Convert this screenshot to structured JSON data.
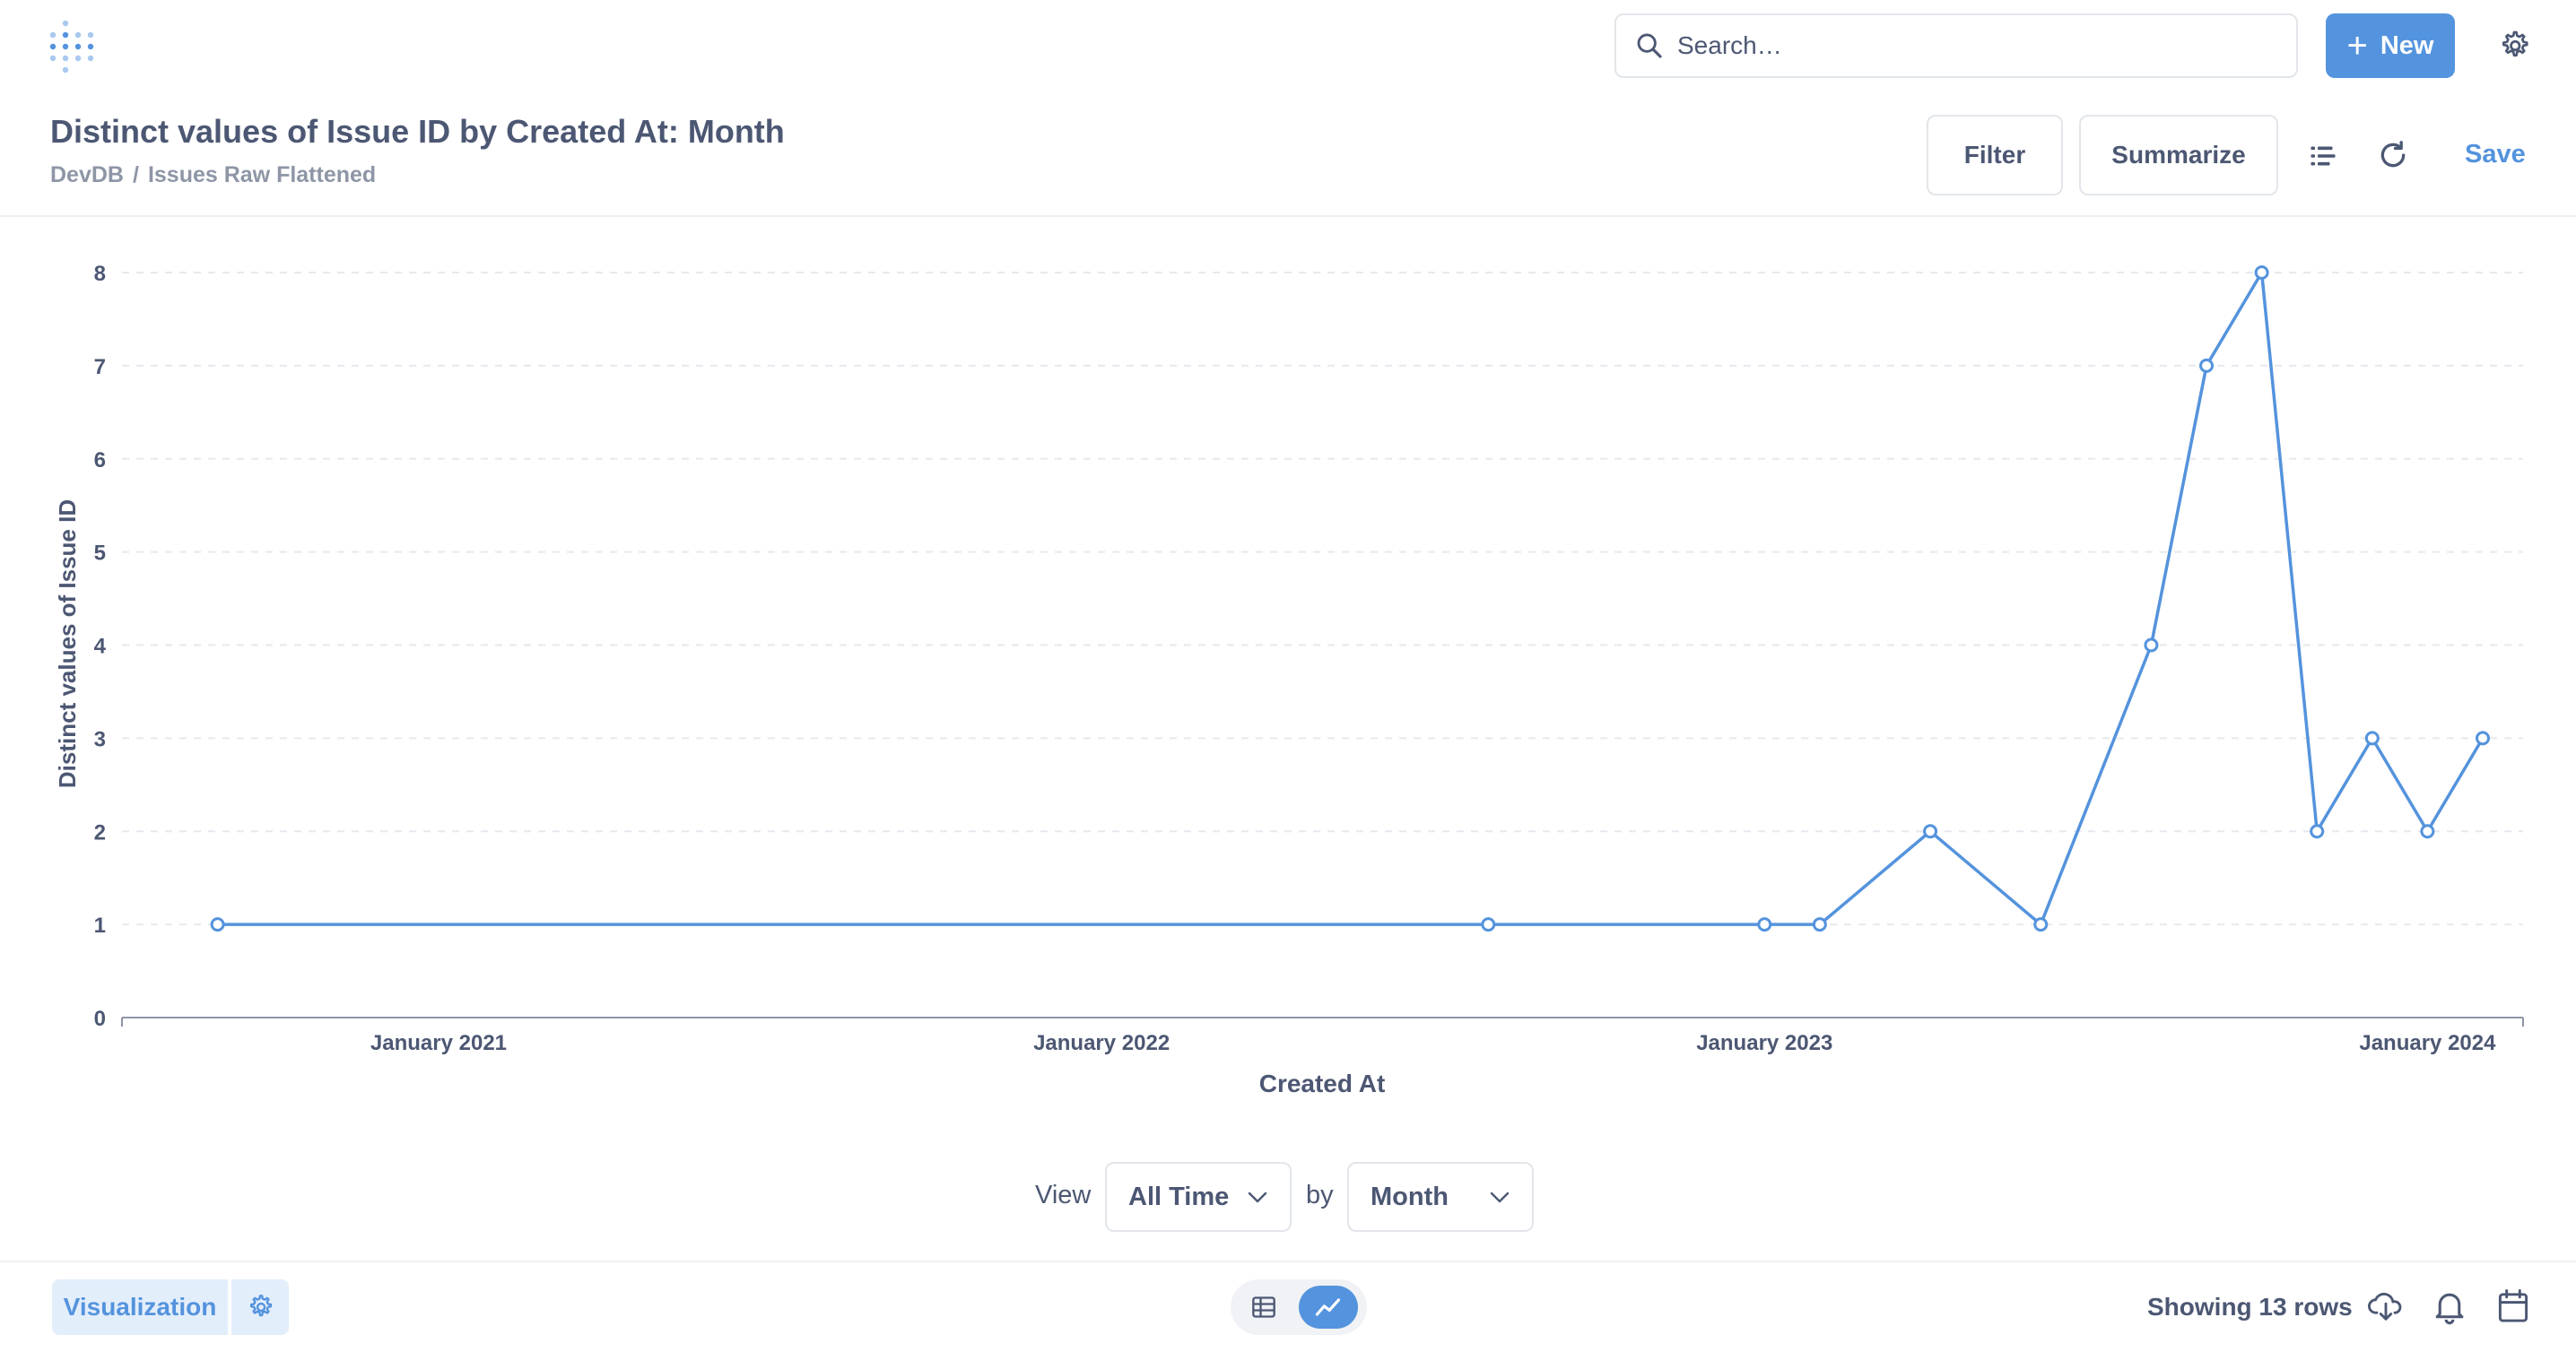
{
  "app": {
    "logo_icon": "metabase-logo-icon",
    "brand_color": "#5493dd"
  },
  "nav": {
    "search_placeholder": "Search…",
    "new_label": "New",
    "new_icon": "plus-icon",
    "settings_icon": "gear-icon"
  },
  "header": {
    "title": "Distinct values of Issue ID by Created At: Month",
    "breadcrumb": [
      "DevDB",
      "Issues Raw Flattened"
    ],
    "breadcrumb_sep": "/",
    "filter_label": "Filter",
    "summarize_label": "Summarize",
    "save_label": "Save"
  },
  "view_controls": {
    "view_label": "View",
    "range_value": "All Time",
    "by_label": "by",
    "unit_value": "Month"
  },
  "footer": {
    "visualization_label": "Visualization",
    "row_count": "Showing 13 rows"
  },
  "chart_data": {
    "type": "line",
    "xlabel": "Created At",
    "ylabel": "Distinct values of Issue ID",
    "ylim": [
      0,
      8
    ],
    "yticks": [
      0,
      1,
      2,
      3,
      4,
      5,
      6,
      7,
      8
    ],
    "xlim": [
      "2020-08",
      "2024-02"
    ],
    "xticks": [
      {
        "label": "January 2021",
        "date": "2021-01"
      },
      {
        "label": "January 2022",
        "date": "2022-01"
      },
      {
        "label": "January 2023",
        "date": "2023-01"
      },
      {
        "label": "January 2024",
        "date": "2024-01"
      }
    ],
    "grid": "horizontal-dashed",
    "color": "#5493dd",
    "series": [
      {
        "points": [
          {
            "x": "2020-09",
            "y": 1
          },
          {
            "x": "2022-08",
            "y": 1
          },
          {
            "x": "2023-01",
            "y": 1
          },
          {
            "x": "2023-02",
            "y": 1
          },
          {
            "x": "2023-04",
            "y": 2
          },
          {
            "x": "2023-06",
            "y": 1
          },
          {
            "x": "2023-08",
            "y": 4
          },
          {
            "x": "2023-09",
            "y": 7
          },
          {
            "x": "2023-10",
            "y": 8
          },
          {
            "x": "2023-11",
            "y": 2
          },
          {
            "x": "2023-12",
            "y": 3
          },
          {
            "x": "2024-01",
            "y": 2
          },
          {
            "x": "2024-02",
            "y": 3
          }
        ]
      }
    ]
  }
}
